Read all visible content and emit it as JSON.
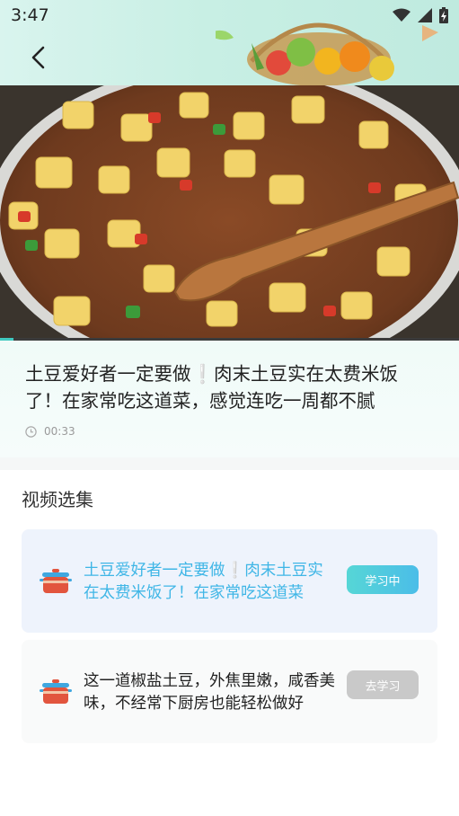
{
  "status_bar": {
    "time": "3:47"
  },
  "video": {
    "progress": 0.03
  },
  "video_info": {
    "title": "土豆爱好者一定要做❕肉末土豆实在太费米饭了！在家常吃这道菜，感觉连吃一周都不腻",
    "duration": "00:33"
  },
  "playlist": {
    "heading": "视频选集",
    "episodes": [
      {
        "title": "土豆爱好者一定要做❕肉末土豆实在太费米饭了！在家常吃这道菜",
        "button": "学习中"
      },
      {
        "title": "这一道椒盐土豆，外焦里嫩，咸香美味，不经常下厨房也能轻松做好",
        "button": "去学习"
      }
    ]
  },
  "colors": {
    "accent": "#3fb6e6",
    "teal": "#41c9c0",
    "active_button": "#4bbde8",
    "inactive_button": "#c9c9c9"
  }
}
